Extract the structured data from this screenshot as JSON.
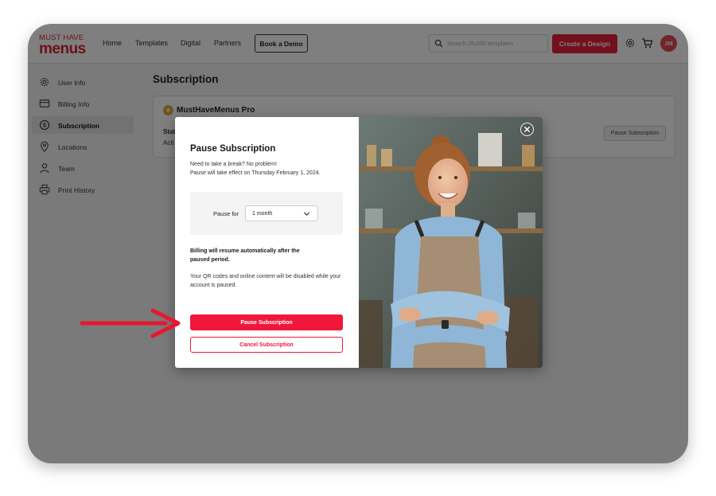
{
  "header": {
    "logo_line1": "MUST HAVE",
    "logo_line2": "menus",
    "nav": [
      "Home",
      "Templates",
      "Digital",
      "Partners"
    ],
    "demo_label": "Book a Demo",
    "search_placeholder": "Search 25,000 templates",
    "create_label": "Create a Design",
    "avatar_initials": "JM"
  },
  "sidebar": {
    "items": [
      {
        "label": "User Info",
        "icon": "gear-icon"
      },
      {
        "label": "Billing Info",
        "icon": "card-icon"
      },
      {
        "label": "Subscription",
        "icon": "dollar-icon",
        "active": true
      },
      {
        "label": "Locations",
        "icon": "pin-icon"
      },
      {
        "label": "Team",
        "icon": "person-icon"
      },
      {
        "label": "Print History",
        "icon": "printer-icon"
      }
    ]
  },
  "main": {
    "title": "Subscription",
    "plan_name": "MustHaveMenus Pro",
    "status_label": "Stat",
    "status_value": "Acti",
    "pause_button": "Pause Subscription"
  },
  "modal": {
    "title": "Pause Subscription",
    "subtitle_line1": "Need to take a break? No problem!",
    "subtitle_line2": "Pause will take effect on Thursday February 1, 2024.",
    "pause_for_label": "Pause for",
    "pause_for_value": "1 month",
    "billing_note": "Billing will resume automatically after the paused period.",
    "qr_note": "Your QR codes and online content will be disabled while your account is paused.",
    "primary_button": "Pause Subscription",
    "secondary_button": "Cancel Subscription"
  },
  "colors": {
    "brand": "#d8242d",
    "accent": "#f0173a",
    "annotation_arrow": "#e8172f"
  }
}
